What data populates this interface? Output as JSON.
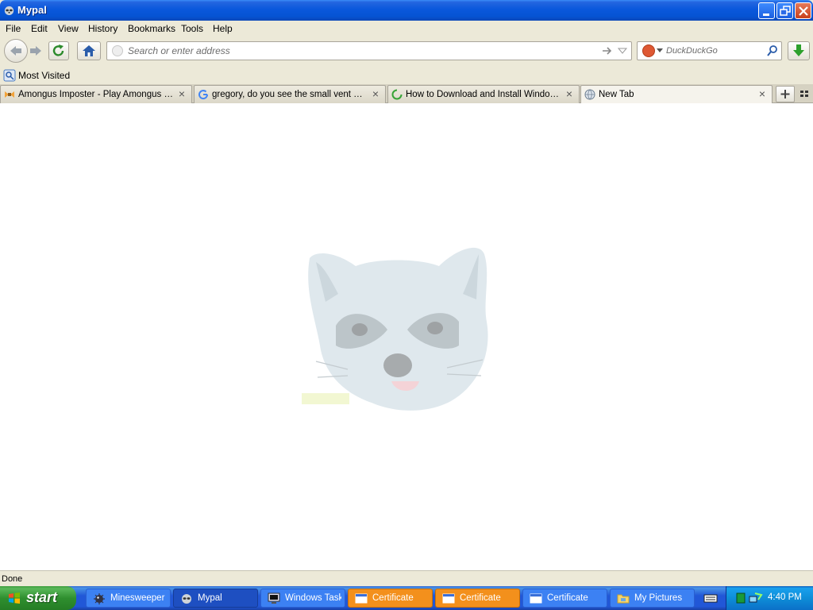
{
  "window": {
    "title": "Mypal",
    "icon": "raccoon-icon"
  },
  "menu": [
    "File",
    "Edit",
    "View",
    "History",
    "Bookmarks",
    "Tools",
    "Help"
  ],
  "navbar": {
    "url_placeholder": "Search or enter address",
    "search_placeholder": "DuckDuckGo",
    "search_engine_icon": "duckduckgo-icon"
  },
  "bookmarks": [
    {
      "label": "Most Visited",
      "icon": "most-visited-icon"
    }
  ],
  "tabs": [
    {
      "label": "Amongus Imposter - Play Amongus Imposter",
      "icon": "game-favicon",
      "active": false
    },
    {
      "label": "gregory, do you see the small vent on the",
      "icon": "google-favicon",
      "active": false
    },
    {
      "label": "How to Download and Install Windows XP",
      "icon": "loading-spinner-icon",
      "active": false
    },
    {
      "label": "New Tab",
      "icon": "globe-favicon",
      "active": true
    }
  ],
  "status": "Done",
  "taskbar": {
    "start_label": "start",
    "tasks": [
      {
        "label": "Minesweeper",
        "icon": "minesweeper-icon",
        "state": "normal"
      },
      {
        "label": "Mypal",
        "icon": "raccoon-icon",
        "state": "active"
      },
      {
        "label": "Windows Task Manager",
        "icon": "task-manager-icon",
        "state": "normal"
      },
      {
        "label": "Certificate",
        "icon": "window-icon",
        "state": "flashing"
      },
      {
        "label": "Certificate",
        "icon": "window-icon",
        "state": "flashing"
      },
      {
        "label": "Certificate",
        "icon": "window-icon",
        "state": "normal"
      },
      {
        "label": "My Pictures",
        "icon": "folder-icon",
        "state": "normal"
      }
    ],
    "clock": "4:40 PM"
  },
  "colors": {
    "titlebar": "#0553d3",
    "taskbar": "#2157d7",
    "start_button": "#2f8f2f",
    "flashing_task": "#f3901c",
    "tray": "#0e8ed8"
  }
}
